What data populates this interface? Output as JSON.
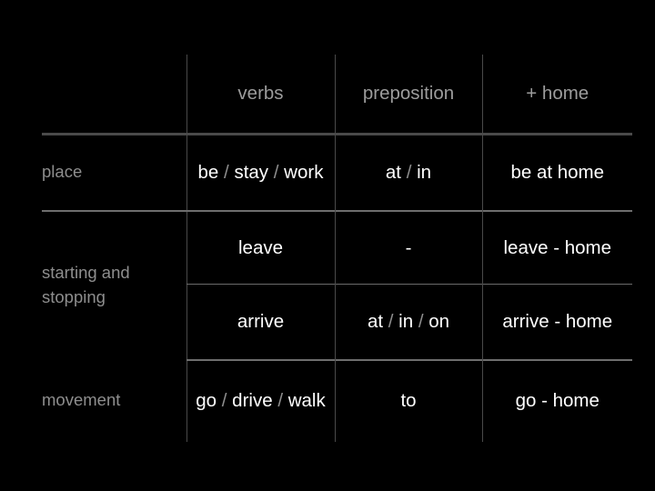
{
  "slide": {
    "background_color": "#000000",
    "header_text_color": "#9c9c9c",
    "body_text_color": "#ffffff",
    "rule_color": "#4a4a4a"
  },
  "table": {
    "headers": {
      "category": "",
      "verbs": "verbs",
      "preposition": "preposition",
      "plus_home": "+ home"
    },
    "rows": [
      {
        "category": "place",
        "subrows": [
          {
            "verbs": "be / stay / work",
            "verbs_parts": [
              "be",
              "/",
              "stay",
              "/",
              "work"
            ],
            "preposition": "at / in",
            "preposition_parts": [
              "at",
              "/",
              "in"
            ],
            "plus_home": "be at home"
          }
        ]
      },
      {
        "category": "starting and stopping",
        "subrows": [
          {
            "verbs": "leave",
            "preposition": "-",
            "plus_home": "leave - home"
          },
          {
            "verbs": "arrive",
            "preposition": "at / in / on",
            "preposition_parts": [
              "at",
              "/",
              "in",
              "/",
              "on"
            ],
            "plus_home": "arrive - home"
          }
        ]
      },
      {
        "category": "movement",
        "subrows": [
          {
            "verbs": "go / drive / walk",
            "verbs_parts": [
              "go",
              "/",
              "drive",
              "/",
              "walk"
            ],
            "preposition": "to",
            "plus_home": "go - home"
          }
        ]
      }
    ]
  }
}
